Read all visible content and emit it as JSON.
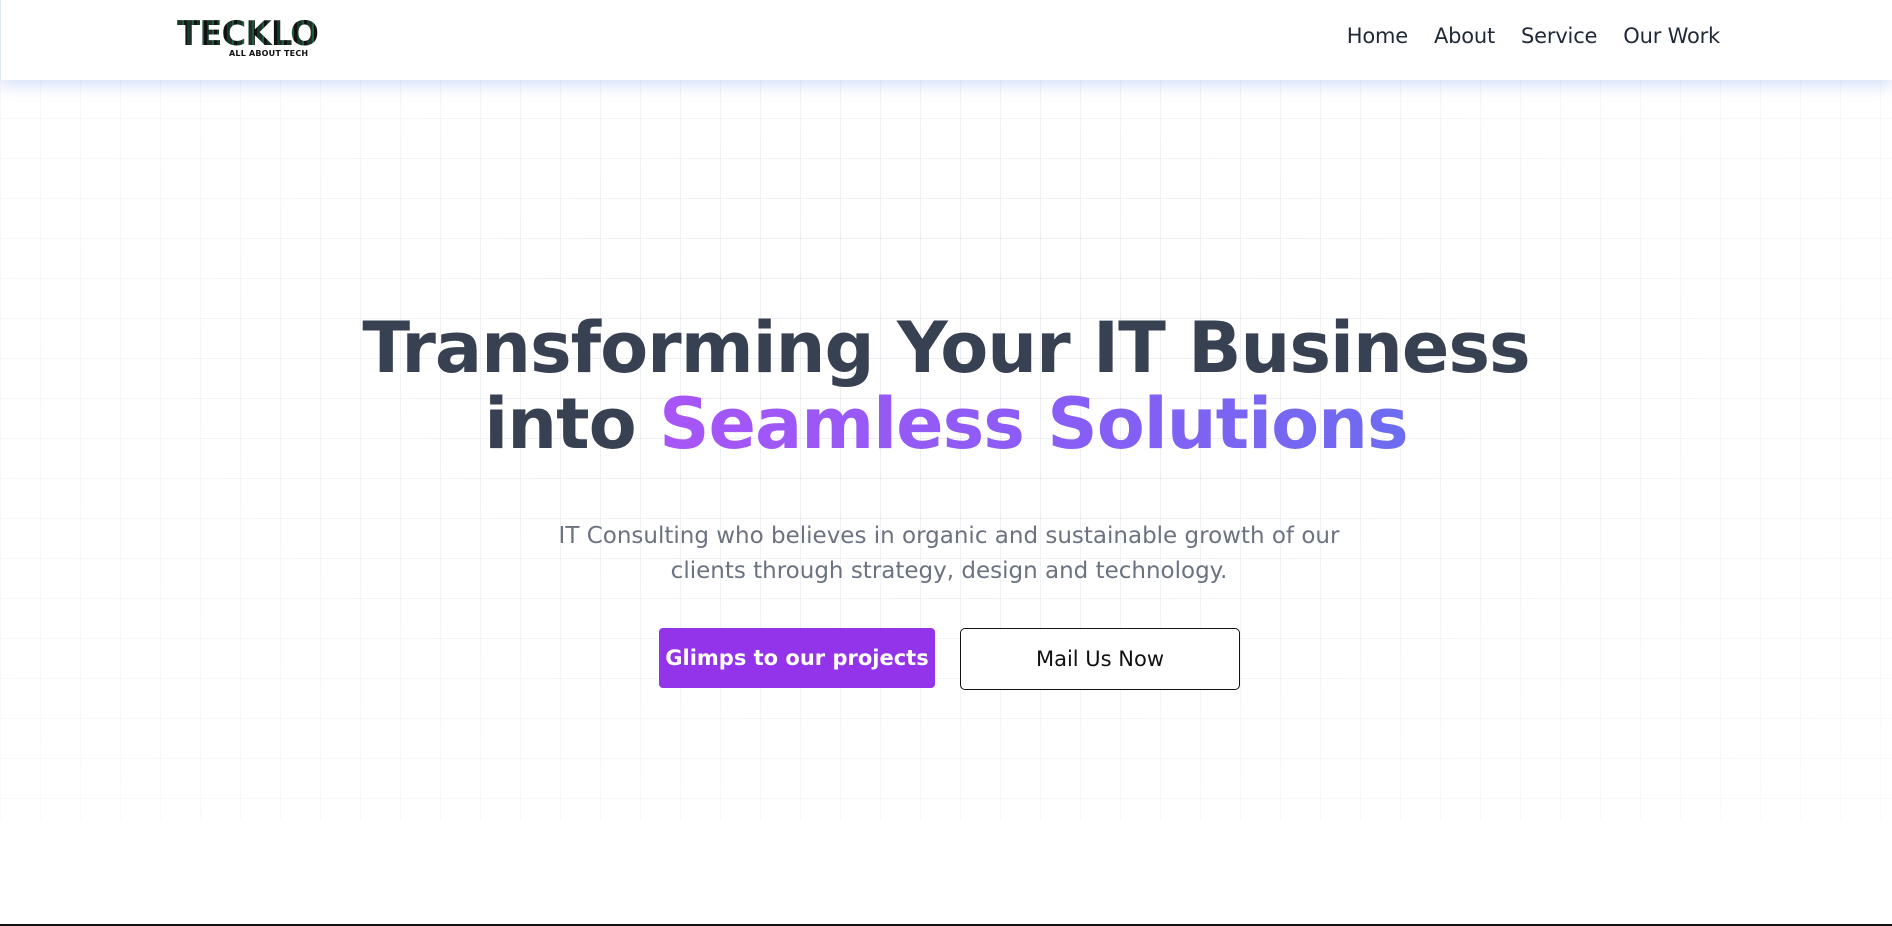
{
  "header": {
    "logo_text": "TECKLO",
    "logo_tagline": "ALL ABOUT TECH",
    "nav": [
      {
        "label": "Home"
      },
      {
        "label": "About"
      },
      {
        "label": "Service"
      },
      {
        "label": "Our Work"
      }
    ]
  },
  "hero": {
    "headline_line1": "Transforming Your IT Business",
    "headline_line2_prefix": "into ",
    "headline_line2_accent": "Seamless Solutions",
    "subtitle": "IT Consulting who believes in organic and sustainable growth of our clients through strategy, design and technology.",
    "primary_button": "Glimps to our projects",
    "secondary_button": "Mail Us Now"
  },
  "colors": {
    "accent": "#9333ea",
    "accent_gradient_start": "#a855f7",
    "accent_gradient_end": "#6d6cf0",
    "headline": "#374151",
    "subtitle": "#6b7280"
  }
}
